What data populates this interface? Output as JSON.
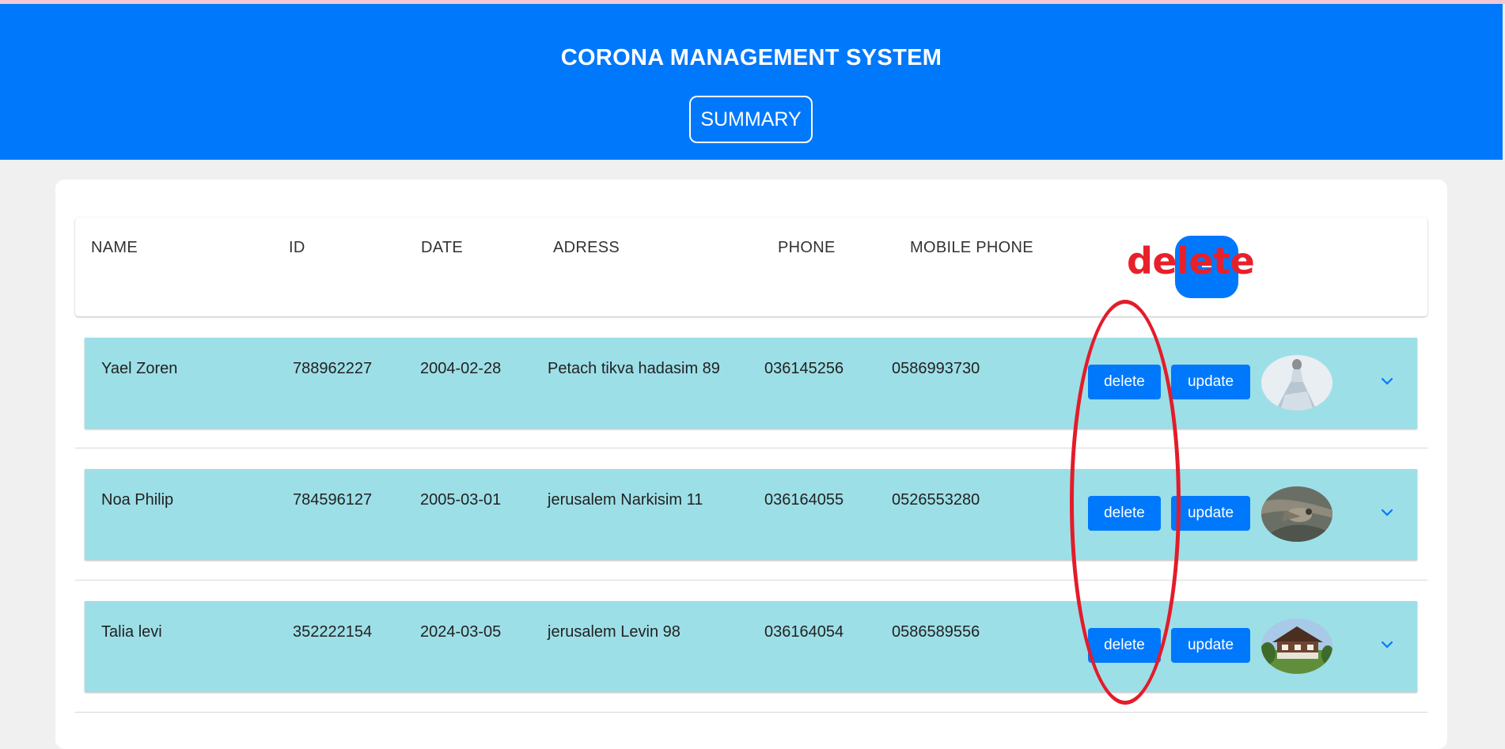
{
  "header": {
    "title": "CORONA MANAGEMENT SYSTEM",
    "summary_label": "SUMMARY"
  },
  "columns": [
    "NAME",
    "ID",
    "DATE",
    "ADRESS",
    "PHONE",
    "MOBILE PHONE"
  ],
  "annotation": {
    "word": "delete",
    "color": "#e31c2a"
  },
  "actions": {
    "delete_label": "delete",
    "update_label": "update"
  },
  "rows": [
    {
      "name": "Yael Zoren",
      "id": "788962227",
      "date": "2004-02-28",
      "address": "Petach tikva hadasim 89",
      "phone": "036145256",
      "mobile": "0586993730",
      "avatar": "photo-dress"
    },
    {
      "name": "Noa Philip",
      "id": "784596127",
      "date": "2005-03-01",
      "address": "jerusalem Narkisim 11",
      "phone": "036164055",
      "mobile": "0526553280",
      "avatar": "photo-bird"
    },
    {
      "name": "Talia levi",
      "id": "352222154",
      "date": "2024-03-05",
      "address": "jerusalem Levin 98",
      "phone": "036164054",
      "mobile": "0586589556",
      "avatar": "photo-house"
    }
  ],
  "colors": {
    "primary": "#0078fc",
    "row_bg": "#9ddfe7",
    "page_bg": "#f0f0f0"
  }
}
